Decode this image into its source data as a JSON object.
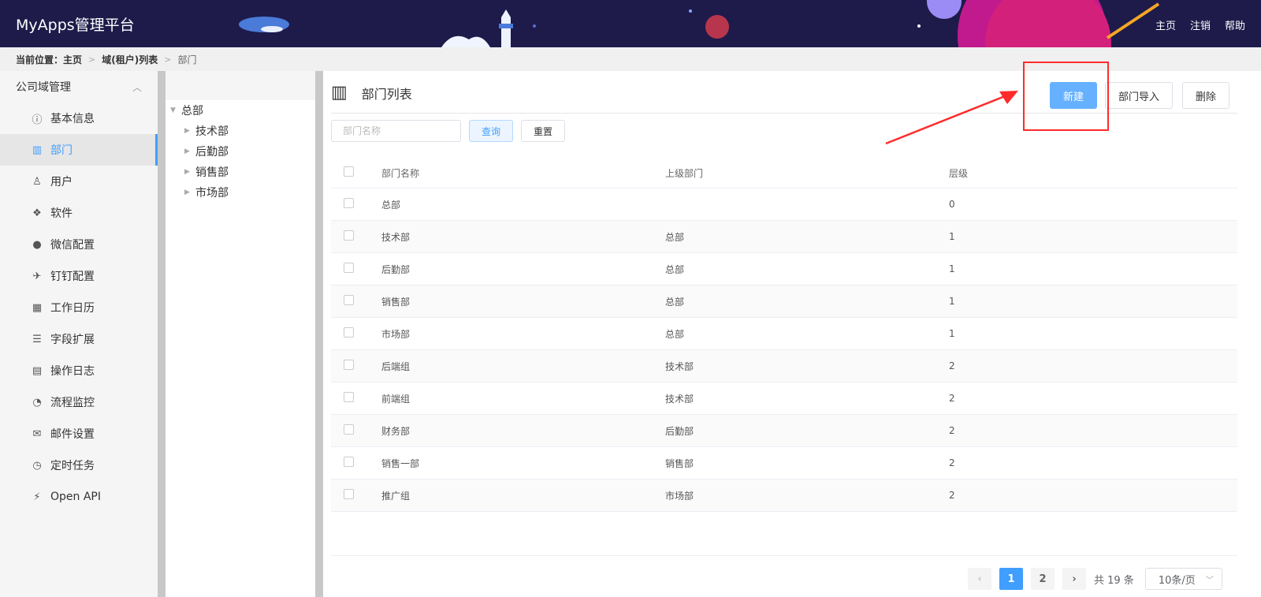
{
  "header": {
    "title": "MyApps管理平台",
    "nav": [
      "主页",
      "注销",
      "帮助"
    ]
  },
  "breadcrumb": {
    "label": "当前位置：",
    "items": [
      "主页",
      "域(租户)列表",
      "部门"
    ]
  },
  "sidebar": {
    "group_title": "公司域管理",
    "items": [
      {
        "label": "基本信息",
        "icon": "info-circle-icon"
      },
      {
        "label": "部门",
        "icon": "building-icon"
      },
      {
        "label": "用户",
        "icon": "user-icon"
      },
      {
        "label": "软件",
        "icon": "cubes-icon"
      },
      {
        "label": "微信配置",
        "icon": "wechat-icon"
      },
      {
        "label": "钉钉配置",
        "icon": "plane-icon"
      },
      {
        "label": "工作日历",
        "icon": "calendar-icon"
      },
      {
        "label": "字段扩展",
        "icon": "sliders-icon"
      },
      {
        "label": "操作日志",
        "icon": "log-icon"
      },
      {
        "label": "流程监控",
        "icon": "dashboard-icon"
      },
      {
        "label": "邮件设置",
        "icon": "envelope-icon"
      },
      {
        "label": "定时任务",
        "icon": "clock-icon"
      },
      {
        "label": "Open API",
        "icon": "plug-icon"
      }
    ],
    "active_index": 1
  },
  "tree": {
    "root": "总部",
    "children": [
      "技术部",
      "后勤部",
      "销售部",
      "市场部"
    ]
  },
  "main": {
    "title": "部门列表",
    "buttons": {
      "new": "新建",
      "import": "部门导入",
      "delete": "删除"
    },
    "search": {
      "placeholder": "部门名称",
      "query": "查询",
      "reset": "重置"
    },
    "table": {
      "headers": [
        "部门名称",
        "上级部门",
        "层级"
      ],
      "rows": [
        [
          "总部",
          "",
          "0"
        ],
        [
          "技术部",
          "总部",
          "1"
        ],
        [
          "后勤部",
          "总部",
          "1"
        ],
        [
          "销售部",
          "总部",
          "1"
        ],
        [
          "市场部",
          "总部",
          "1"
        ],
        [
          "后端组",
          "技术部",
          "2"
        ],
        [
          "前端组",
          "技术部",
          "2"
        ],
        [
          "财务部",
          "后勤部",
          "2"
        ],
        [
          "销售一部",
          "销售部",
          "2"
        ],
        [
          "推广组",
          "市场部",
          "2"
        ]
      ]
    },
    "pagination": {
      "pages": [
        "1",
        "2"
      ],
      "current": "1",
      "total": "共 19 条",
      "page_size": "10条/页"
    }
  },
  "colors": {
    "header_bg": "#1e1b4b",
    "accent": "#409eff",
    "primary_button": "#66b1ff",
    "annotation": "#ff2a2a"
  }
}
